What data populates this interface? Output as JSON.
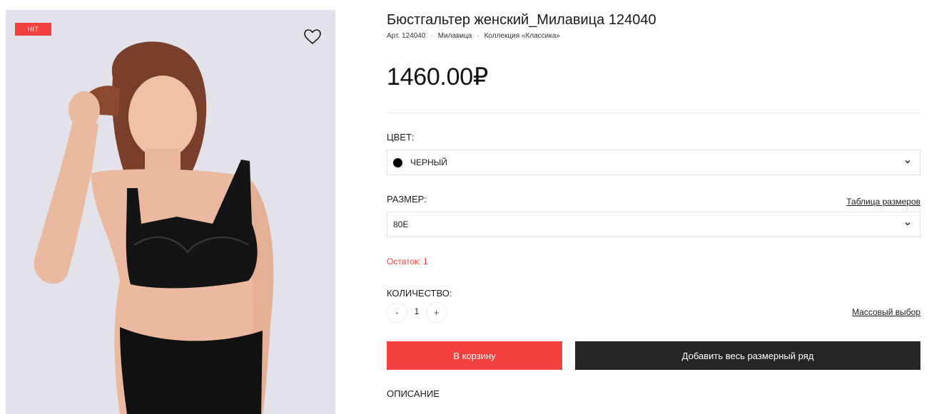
{
  "colors": {
    "accent": "#f43f3f",
    "dark_button": "#262626",
    "stock_text": "#f2403f",
    "photo_background": "#e3e2ea"
  },
  "gallery": {
    "badge": "HIT",
    "favorite_icon": "heart-icon"
  },
  "product": {
    "title": "Бюстгальтер женский_Милавица 124040",
    "sku": "Арт. 124040",
    "brand": "Милавица",
    "collection": "Коллекция «Классика»",
    "separator": "·",
    "price": "1460.00₽"
  },
  "color_field": {
    "label": "ЦВЕТ:",
    "value": "ЧЕРНЫЙ",
    "swatch": "#000000",
    "icon": "chevron-down-icon"
  },
  "size_field": {
    "label": "РАЗМЕР:",
    "value": "80E",
    "size_table_link": "Таблица размеров",
    "icon": "chevron-down-icon"
  },
  "stock": "Остаток: 1",
  "quantity": {
    "label": "КОЛИЧЕСТВО:",
    "minus": "-",
    "value": "1",
    "plus": "+",
    "bulk_link": "Массовый выбор"
  },
  "actions": {
    "add_to_cart": "В корзину",
    "add_size_range": "Добавить весь размерный ряд"
  },
  "description_title": "ОПИСАНИЕ"
}
